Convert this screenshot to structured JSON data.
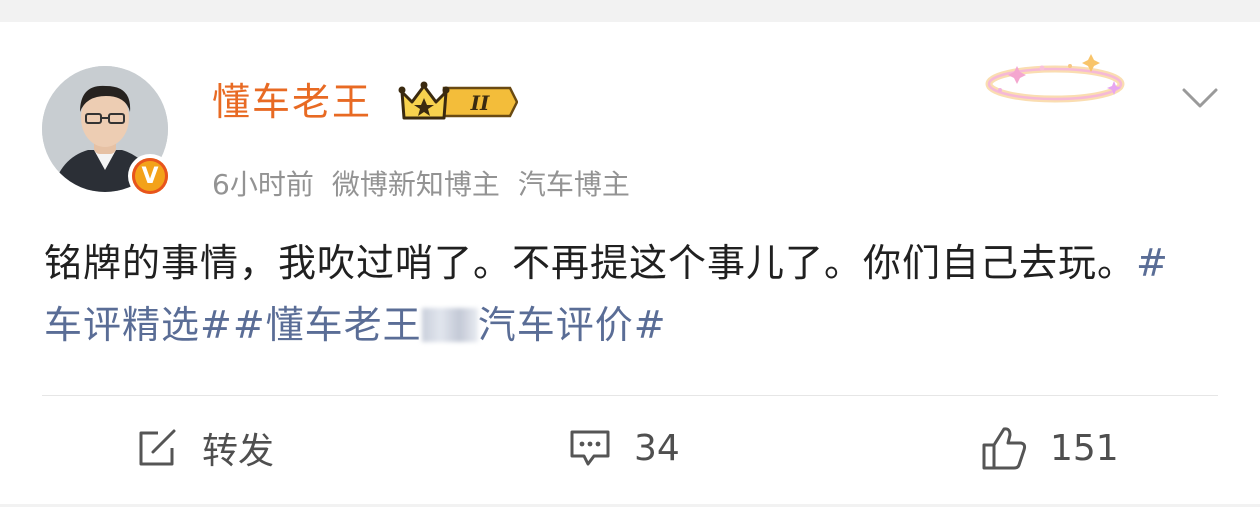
{
  "post": {
    "author": {
      "name": "懂车老王",
      "level_badge": "II",
      "verified_mark": "V"
    },
    "meta": {
      "time": "6小时前",
      "tag1": "微博新知博主",
      "tag2": "汽车博主"
    },
    "content": {
      "text": "铭牌的事情，我吹过哨了。不再提这个事儿了。你们自己去玩。",
      "hashtag1": "#车评精选#",
      "hashtag2": "#懂车老王",
      "hashtag3": "汽车评价#"
    },
    "actions": {
      "repost_label": "转发",
      "comment_count": "34",
      "like_count": "151"
    }
  },
  "icons": {
    "repost": "edit-square-icon",
    "comment": "comment-bubble-icon",
    "like": "thumbs-up-icon",
    "menu": "chevron-down-icon",
    "crown": "crown-badge-icon",
    "decoration": "sparkle-ring-decoration-icon"
  },
  "colors": {
    "username": "#e86a23",
    "hashtag": "#5a6d96",
    "meta": "#939393",
    "body_text": "#202020"
  }
}
